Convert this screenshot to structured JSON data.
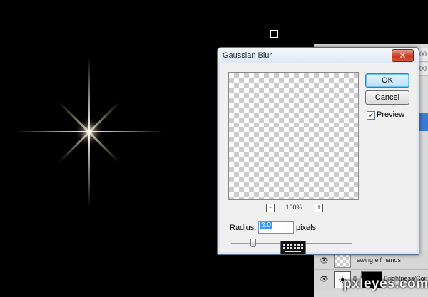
{
  "dialog": {
    "title": "Gaussian Blur",
    "close_label": "✕",
    "ok_label": "OK",
    "cancel_label": "Cancel",
    "preview_label": "Preview",
    "preview_checked": true,
    "zoom_out_label": "-",
    "zoom_in_label": "+",
    "zoom_level": "100%",
    "radius_label": "Radius:",
    "radius_value": "3.0",
    "radius_unit": "pixels"
  },
  "layers": {
    "strip_values": [
      "100",
      "100"
    ],
    "items": [
      {
        "name": "swing elf hands"
      },
      {
        "name": "Brightness/Con"
      }
    ]
  },
  "watermark": "pxleyes.com",
  "colors": {
    "canvas_bg": "#000000",
    "dialog_frame": "#dce6f1",
    "dialog_body": "#f0f0f0",
    "close_red": "#c33a22",
    "ok_blue": "#bde0f5",
    "selection": "#3399ff"
  },
  "icons": {
    "close": "close-icon",
    "check": "checkmark-icon",
    "eye": "eye-icon",
    "keyboard": "keyboard-icon",
    "adjustment": "brightness-contrast-icon"
  }
}
